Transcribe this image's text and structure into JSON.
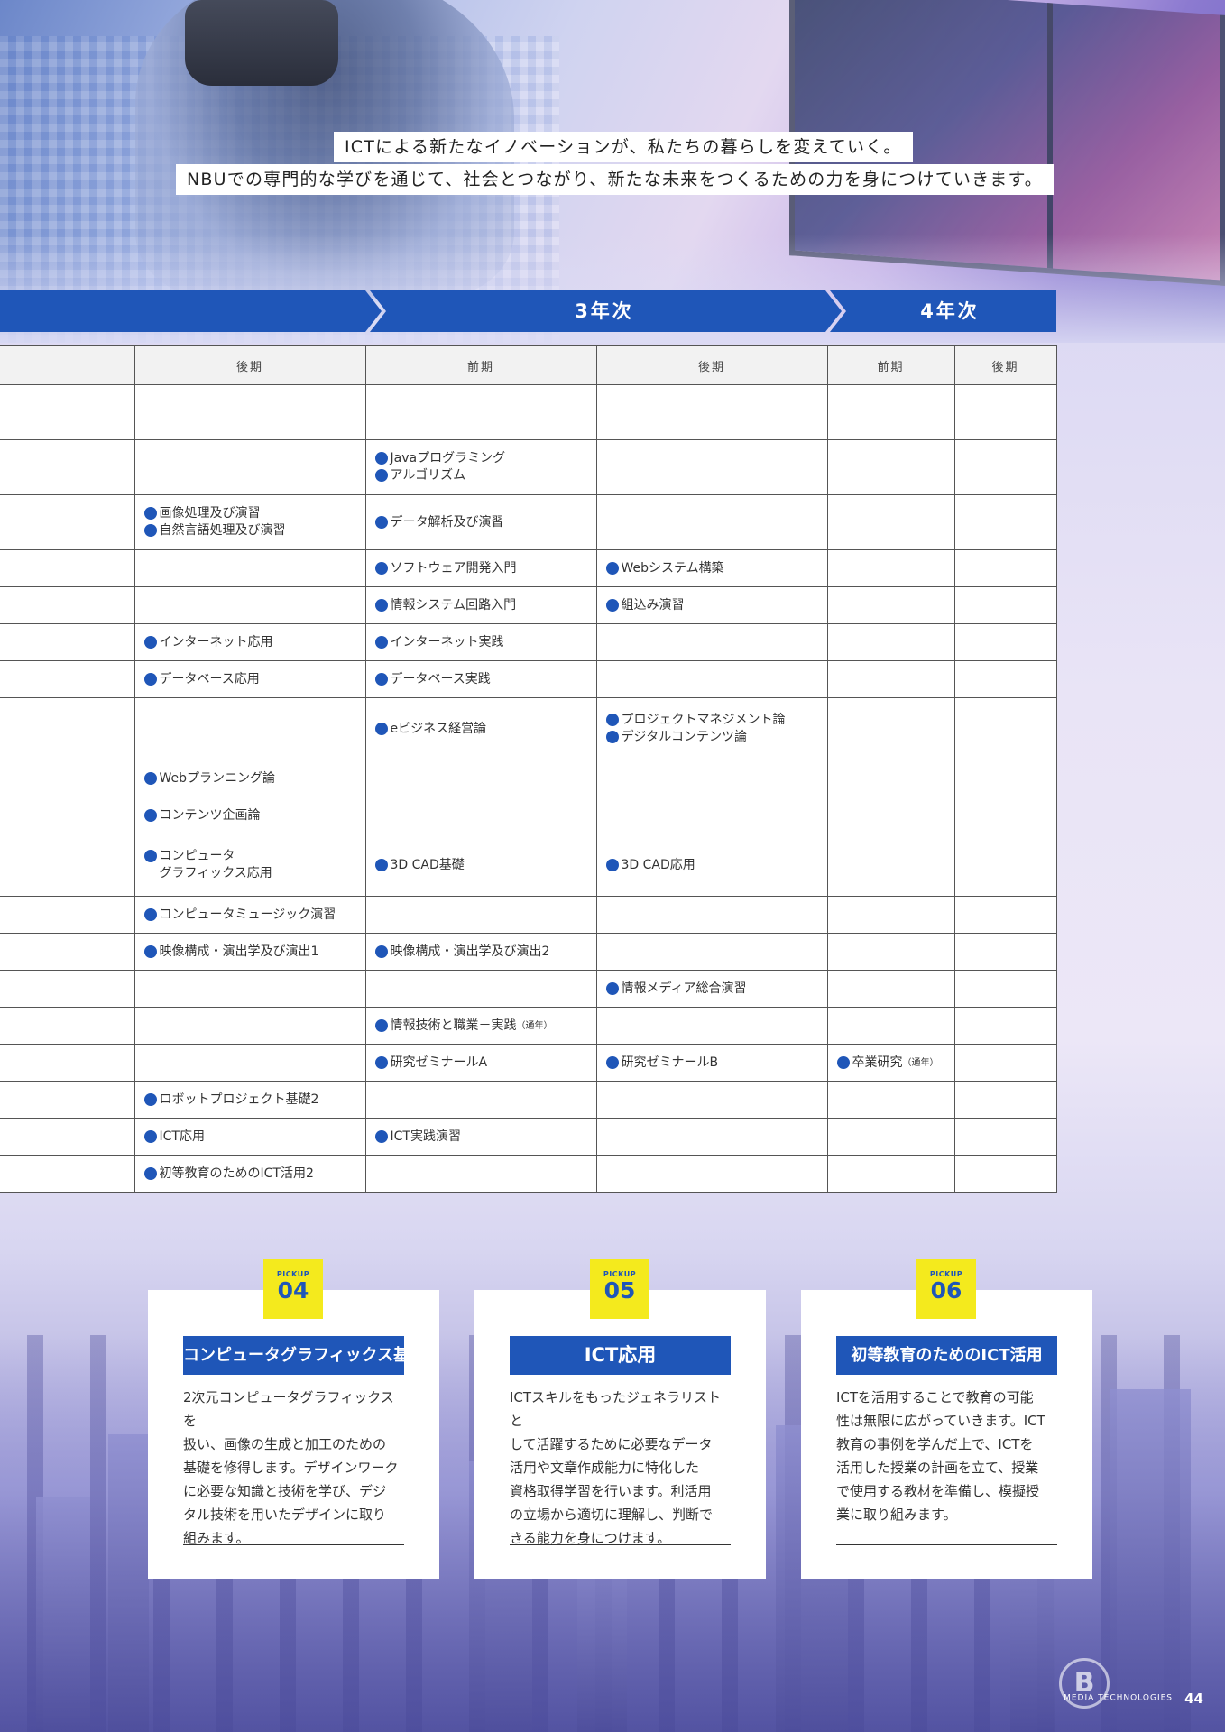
{
  "hero": {
    "line1": "ICTによる新たなイノベーションが、私たちの暮らしを変えていく。",
    "line2": "NBUでの専門的な学びを通じて、社会とつながり、新たな未来をつくるための力を身につけていきます。"
  },
  "banner": {
    "year3": "3年次",
    "year4": "4年次"
  },
  "table": {
    "headers": [
      "後期",
      "前期",
      "後期",
      "前期",
      "後期"
    ],
    "rows": [
      {
        "c1": [],
        "c2": [],
        "c3": []
      },
      {
        "c1": [],
        "c2": [
          "Javaプログラミング",
          "アルゴリズム"
        ],
        "c3": []
      },
      {
        "c1": [
          "画像処理及び演習",
          "自然言語処理及び演習"
        ],
        "c2": [
          "データ解析及び演習"
        ],
        "c3": []
      },
      {
        "c1": [],
        "c2": [
          "ソフトウェア開発入門"
        ],
        "c3": [
          "Webシステム構築"
        ]
      },
      {
        "c1": [],
        "c2": [
          "情報システム回路入門"
        ],
        "c3": [
          "組込み演習"
        ]
      },
      {
        "c1": [
          "インターネット応用"
        ],
        "c2": [
          "インターネット実践"
        ],
        "c3": []
      },
      {
        "c1": [
          "データベース応用"
        ],
        "c2": [
          "データベース実践"
        ],
        "c3": []
      },
      {
        "c1": [],
        "c2": [
          "eビジネス経営論"
        ],
        "c3": [
          "プロジェクトマネジメント論",
          "デジタルコンテンツ論"
        ]
      },
      {
        "c1": [
          "Webプランニング論"
        ],
        "c2": [],
        "c3": []
      },
      {
        "c1": [
          "コンテンツ企画論"
        ],
        "c2": [],
        "c3": []
      },
      {
        "c1": [
          "コンピュータ\nグラフィックス応用"
        ],
        "c2": [
          "3D CAD基礎"
        ],
        "c3": [
          "3D CAD応用"
        ]
      },
      {
        "c1": [
          "コンピュータミュージック演習"
        ],
        "c2": [],
        "c3": []
      },
      {
        "c1": [
          "映像構成・演出学及び演出1"
        ],
        "c2": [
          "映像構成・演出学及び演出2"
        ],
        "c3": []
      },
      {
        "c1": [],
        "c2": [],
        "c3": [
          "情報メディア総合演習"
        ]
      },
      {
        "c1": [],
        "c2": [
          "情報技術と職業－実践"
        ],
        "c2_note": "（通年）",
        "c3": []
      },
      {
        "c1": [],
        "c2": [
          "研究ゼミナールA"
        ],
        "c3": [
          "研究ゼミナールB"
        ],
        "c4": "卒業研究",
        "c4_note": "（通年）"
      },
      {
        "c1": [
          "ロボットプロジェクト基礎2"
        ],
        "c2": [],
        "c3": []
      },
      {
        "c1": [
          "ICT応用"
        ],
        "c2": [
          "ICT実践演習"
        ],
        "c3": []
      },
      {
        "c1": [
          "初等教育のためのICT活用2"
        ],
        "c2": [],
        "c3": []
      }
    ]
  },
  "pickups": [
    {
      "label": "PICKUP",
      "number": "04",
      "title": "コンピュータグラフィックス基礎",
      "lines": [
        "2次元コンピュータグラフィックスを",
        "扱い、画像の生成と加工のための",
        "基礎を修得します。デザインワーク",
        "に必要な知識と技術を学び、デジ",
        "タル技術を用いたデザインに取り",
        "組みます。"
      ]
    },
    {
      "label": "PICKUP",
      "number": "05",
      "title": "ICT応用",
      "lines": [
        "ICTスキルをもったジェネラリストと",
        "して活躍するために必要なデータ",
        "活用や文章作成能力に特化した",
        "資格取得学習を行います。利活用",
        "の立場から適切に理解し、判断で",
        "きる能力を身につけます。"
      ]
    },
    {
      "label": "PICKUP",
      "number": "06",
      "title": "初等教育のためのICT活用",
      "lines": [
        "ICTを活用することで教育の可能",
        "性は無限に広がっていきます。ICT",
        "教育の事例を学んだ上で、ICTを",
        "活用した授業の計画を立て、授業",
        "で使用する教材を準備し、模擬授",
        "業に取り組みます。"
      ]
    }
  ],
  "footer": {
    "section": "MEDIA TECHNOLOGIES",
    "page": "44"
  },
  "colors": {
    "accent_blue": "#1f56b8",
    "badge_yellow": "#f4ea1d"
  }
}
